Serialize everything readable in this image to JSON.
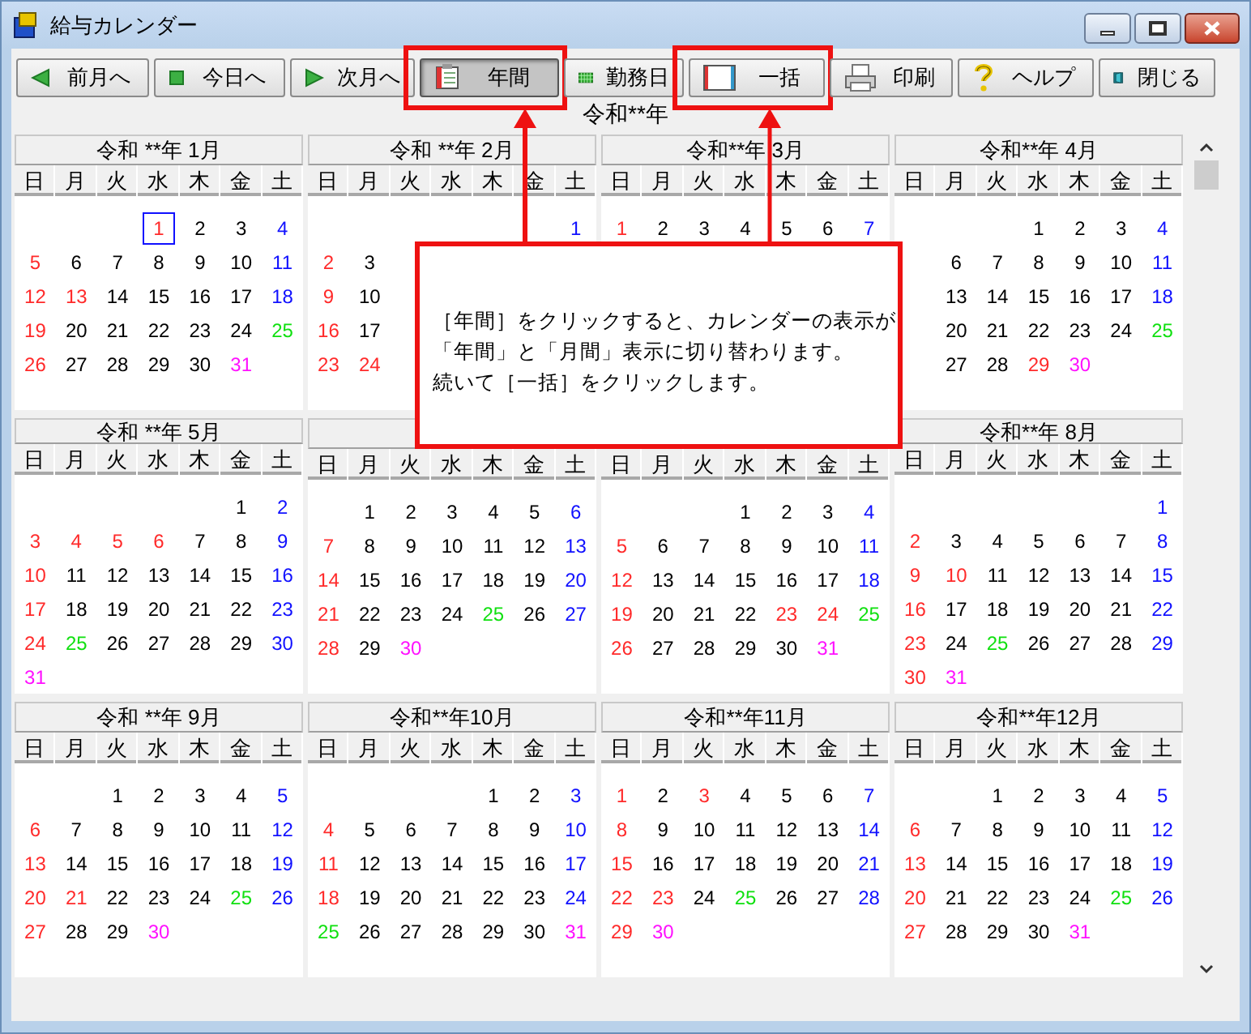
{
  "window": {
    "title": "給与カレンダー"
  },
  "toolbar": [
    {
      "label": "前月へ",
      "selected": false,
      "highlighted": false
    },
    {
      "label": "今日へ",
      "selected": false,
      "highlighted": false
    },
    {
      "label": "次月へ",
      "selected": false,
      "highlighted": false
    },
    {
      "label": "年間",
      "selected": true,
      "highlighted": true
    },
    {
      "label": "勤務日",
      "selected": false,
      "highlighted": false
    },
    {
      "label": "一括",
      "selected": false,
      "highlighted": true
    },
    {
      "label": "印刷",
      "selected": false,
      "highlighted": false
    },
    {
      "label": "ヘルプ",
      "selected": false,
      "highlighted": false
    },
    {
      "label": "閉じる",
      "selected": false,
      "highlighted": false
    }
  ],
  "year_title": "令和**年",
  "months": [
    {
      "title": "令和 **年 1月",
      "weekdays": [
        "日",
        "月",
        "火",
        "水",
        "木",
        "金",
        "土"
      ],
      "weeks": [
        [
          {
            "day": "1",
            "kind": "today"
          },
          {
            "day": "2",
            "kind": "plain"
          },
          {
            "day": "3",
            "kind": "plain"
          },
          {
            "day": "4",
            "kind": "sat"
          }
        ],
        [
          {
            "day": "5",
            "kind": "holiday"
          },
          {
            "day": "6",
            "kind": "plain"
          },
          {
            "day": "7",
            "kind": "plain"
          },
          {
            "day": "8",
            "kind": "plain"
          },
          {
            "day": "9",
            "kind": "plain"
          },
          {
            "day": "10",
            "kind": "plain"
          },
          {
            "day": "11",
            "kind": "sat"
          }
        ],
        [
          {
            "day": "12",
            "kind": "holiday"
          },
          {
            "day": "13",
            "kind": "holiday"
          },
          {
            "day": "14",
            "kind": "plain"
          },
          {
            "day": "15",
            "kind": "plain"
          },
          {
            "day": "16",
            "kind": "plain"
          },
          {
            "day": "17",
            "kind": "plain"
          },
          {
            "day": "18",
            "kind": "sat"
          }
        ],
        [
          {
            "day": "19",
            "kind": "holiday"
          },
          {
            "day": "20",
            "kind": "plain"
          },
          {
            "day": "21",
            "kind": "plain"
          },
          {
            "day": "22",
            "kind": "plain"
          },
          {
            "day": "23",
            "kind": "plain"
          },
          {
            "day": "24",
            "kind": "plain"
          },
          {
            "day": "25",
            "kind": "payday"
          }
        ],
        [
          {
            "day": "26",
            "kind": "holiday"
          },
          {
            "day": "27",
            "kind": "plain"
          },
          {
            "day": "28",
            "kind": "plain"
          },
          {
            "day": "29",
            "kind": "plain"
          },
          {
            "day": "30",
            "kind": "plain"
          },
          {
            "day": "31",
            "kind": "end"
          }
        ]
      ]
    },
    {
      "title": "令和 **年 2月",
      "weekdays": [
        "日",
        "月",
        "火",
        "水",
        "木",
        "金",
        "土"
      ],
      "weeks": [
        [
          {
            "day": "1",
            "kind": "sat"
          }
        ],
        [
          {
            "day": "2",
            "kind": "holiday"
          },
          {
            "day": "3",
            "kind": "plain"
          }
        ],
        [
          {
            "day": "9",
            "kind": "holiday"
          },
          {
            "day": "10",
            "kind": "plain"
          }
        ],
        [
          {
            "day": "16",
            "kind": "holiday"
          },
          {
            "day": "17",
            "kind": "plain"
          }
        ],
        [
          {
            "day": "23",
            "kind": "holiday"
          },
          {
            "day": "24",
            "kind": "holiday"
          }
        ]
      ]
    },
    {
      "title": "令和**年 3月",
      "weekdays": [
        "日",
        "月",
        "火",
        "水",
        "木",
        "金",
        "土"
      ],
      "weeks": [
        [
          {
            "day": "1",
            "kind": "holiday"
          },
          {
            "day": "2",
            "kind": "plain"
          },
          {
            "day": "3",
            "kind": "plain"
          },
          {
            "day": "4",
            "kind": "plain"
          },
          {
            "day": "5",
            "kind": "plain"
          },
          {
            "day": "6",
            "kind": "plain"
          },
          {
            "day": "7",
            "kind": "sat"
          }
        ]
      ]
    },
    {
      "title": "令和**年 4月",
      "weekdays": [
        "日",
        "月",
        "火",
        "水",
        "木",
        "金",
        "土"
      ],
      "weeks": [
        [
          {
            "day": "1",
            "kind": "plain"
          },
          {
            "day": "2",
            "kind": "plain"
          },
          {
            "day": "3",
            "kind": "plain"
          },
          {
            "day": "4",
            "kind": "sat"
          }
        ],
        [
          {
            "kind": "covered"
          },
          {
            "day": "6",
            "kind": "plain"
          },
          {
            "day": "7",
            "kind": "plain"
          },
          {
            "day": "8",
            "kind": "plain"
          },
          {
            "day": "9",
            "kind": "plain"
          },
          {
            "day": "10",
            "kind": "plain"
          },
          {
            "day": "11",
            "kind": "sat"
          }
        ],
        [
          {
            "kind": "covered"
          },
          {
            "day": "13",
            "kind": "plain"
          },
          {
            "day": "14",
            "kind": "plain"
          },
          {
            "day": "15",
            "kind": "plain"
          },
          {
            "day": "16",
            "kind": "plain"
          },
          {
            "day": "17",
            "kind": "plain"
          },
          {
            "day": "18",
            "kind": "sat"
          }
        ],
        [
          {
            "kind": "covered"
          },
          {
            "day": "20",
            "kind": "plain"
          },
          {
            "day": "21",
            "kind": "plain"
          },
          {
            "day": "22",
            "kind": "plain"
          },
          {
            "day": "23",
            "kind": "plain"
          },
          {
            "day": "24",
            "kind": "plain"
          },
          {
            "day": "25",
            "kind": "payday"
          }
        ],
        [
          {
            "kind": "covered"
          },
          {
            "day": "27",
            "kind": "plain"
          },
          {
            "day": "28",
            "kind": "plain"
          },
          {
            "day": "29",
            "kind": "holiday"
          },
          {
            "day": "30",
            "kind": "end"
          }
        ]
      ]
    },
    {
      "title": "令和 **年 5月",
      "weekdays": [
        "日",
        "月",
        "火",
        "水",
        "木",
        "金",
        "土"
      ],
      "weeks": [
        [
          {
            "day": "1",
            "kind": "plain"
          },
          {
            "day": "2",
            "kind": "sat"
          }
        ],
        [
          {
            "day": "3",
            "kind": "holiday"
          },
          {
            "day": "4",
            "kind": "holiday"
          },
          {
            "day": "5",
            "kind": "holiday"
          },
          {
            "day": "6",
            "kind": "holiday"
          },
          {
            "day": "7",
            "kind": "plain"
          },
          {
            "day": "8",
            "kind": "plain"
          },
          {
            "day": "9",
            "kind": "sat"
          }
        ],
        [
          {
            "day": "10",
            "kind": "holiday"
          },
          {
            "day": "11",
            "kind": "plain"
          },
          {
            "day": "12",
            "kind": "plain"
          },
          {
            "day": "13",
            "kind": "plain"
          },
          {
            "day": "14",
            "kind": "plain"
          },
          {
            "day": "15",
            "kind": "plain"
          },
          {
            "day": "16",
            "kind": "sat"
          }
        ],
        [
          {
            "day": "17",
            "kind": "holiday"
          },
          {
            "day": "18",
            "kind": "plain"
          },
          {
            "day": "19",
            "kind": "plain"
          },
          {
            "day": "20",
            "kind": "plain"
          },
          {
            "day": "21",
            "kind": "plain"
          },
          {
            "day": "22",
            "kind": "plain"
          },
          {
            "day": "23",
            "kind": "sat"
          }
        ],
        [
          {
            "day": "24",
            "kind": "holiday"
          },
          {
            "day": "25",
            "kind": "payday"
          },
          {
            "day": "26",
            "kind": "plain"
          },
          {
            "day": "27",
            "kind": "plain"
          },
          {
            "day": "28",
            "kind": "plain"
          },
          {
            "day": "29",
            "kind": "plain"
          },
          {
            "day": "30",
            "kind": "sat"
          }
        ],
        [
          {
            "day": "31",
            "kind": "end"
          }
        ]
      ]
    },
    {
      "header_shown": true,
      "weekdays": [
        "日",
        "月",
        "火",
        "水",
        "木",
        "金",
        "土"
      ],
      "weeks": [
        [
          {
            "day": "1",
            "kind": "plain"
          },
          {
            "day": "2",
            "kind": "plain"
          },
          {
            "day": "3",
            "kind": "plain"
          },
          {
            "day": "4",
            "kind": "plain"
          },
          {
            "day": "5",
            "kind": "plain"
          },
          {
            "day": "6",
            "kind": "sat"
          }
        ],
        [
          {
            "day": "7",
            "kind": "holiday"
          },
          {
            "day": "8",
            "kind": "plain"
          },
          {
            "day": "9",
            "kind": "plain"
          },
          {
            "day": "10",
            "kind": "plain"
          },
          {
            "day": "11",
            "kind": "plain"
          },
          {
            "day": "12",
            "kind": "plain"
          },
          {
            "day": "13",
            "kind": "sat"
          }
        ],
        [
          {
            "day": "14",
            "kind": "holiday"
          },
          {
            "day": "15",
            "kind": "plain"
          },
          {
            "day": "16",
            "kind": "plain"
          },
          {
            "day": "17",
            "kind": "plain"
          },
          {
            "day": "18",
            "kind": "plain"
          },
          {
            "day": "19",
            "kind": "plain"
          },
          {
            "day": "20",
            "kind": "sat"
          }
        ],
        [
          {
            "day": "21",
            "kind": "holiday"
          },
          {
            "day": "22",
            "kind": "plain"
          },
          {
            "day": "23",
            "kind": "plain"
          },
          {
            "day": "24",
            "kind": "plain"
          },
          {
            "day": "25",
            "kind": "payday"
          },
          {
            "day": "26",
            "kind": "plain"
          },
          {
            "day": "27",
            "kind": "sat"
          }
        ],
        [
          {
            "day": "28",
            "kind": "holiday"
          },
          {
            "day": "29",
            "kind": "plain"
          },
          {
            "day": "30",
            "kind": "end"
          }
        ]
      ]
    },
    {
      "weekdays": [
        "日",
        "月",
        "火",
        "水",
        "木",
        "金",
        "土"
      ],
      "weeks": [
        [
          {
            "day": "1",
            "kind": "plain"
          },
          {
            "day": "2",
            "kind": "plain"
          },
          {
            "day": "3",
            "kind": "plain"
          },
          {
            "day": "4",
            "kind": "sat"
          }
        ],
        [
          {
            "day": "5",
            "kind": "holiday"
          },
          {
            "day": "6",
            "kind": "plain"
          },
          {
            "day": "7",
            "kind": "plain"
          },
          {
            "day": "8",
            "kind": "plain"
          },
          {
            "day": "9",
            "kind": "plain"
          },
          {
            "day": "10",
            "kind": "plain"
          },
          {
            "day": "11",
            "kind": "sat"
          }
        ],
        [
          {
            "day": "12",
            "kind": "holiday"
          },
          {
            "day": "13",
            "kind": "plain"
          },
          {
            "day": "14",
            "kind": "plain"
          },
          {
            "day": "15",
            "kind": "plain"
          },
          {
            "day": "16",
            "kind": "plain"
          },
          {
            "day": "17",
            "kind": "plain"
          },
          {
            "day": "18",
            "kind": "sat"
          }
        ],
        [
          {
            "day": "19",
            "kind": "holiday"
          },
          {
            "day": "20",
            "kind": "plain"
          },
          {
            "day": "21",
            "kind": "plain"
          },
          {
            "day": "22",
            "kind": "plain"
          },
          {
            "day": "23",
            "kind": "holiday"
          },
          {
            "day": "24",
            "kind": "holiday"
          },
          {
            "day": "25",
            "kind": "payday"
          }
        ],
        [
          {
            "day": "26",
            "kind": "holiday"
          },
          {
            "day": "27",
            "kind": "plain"
          },
          {
            "day": "28",
            "kind": "plain"
          },
          {
            "day": "29",
            "kind": "plain"
          },
          {
            "day": "30",
            "kind": "plain"
          },
          {
            "day": "31",
            "kind": "end"
          }
        ]
      ]
    },
    {
      "title": "令和**年 8月",
      "weekdays": [
        "日",
        "月",
        "火",
        "水",
        "木",
        "金",
        "土"
      ],
      "weeks": [
        [
          {
            "day": "1",
            "kind": "sat"
          }
        ],
        [
          {
            "day": "2",
            "kind": "holiday"
          },
          {
            "day": "3",
            "kind": "plain"
          },
          {
            "day": "4",
            "kind": "plain"
          },
          {
            "day": "5",
            "kind": "plain"
          },
          {
            "day": "6",
            "kind": "plain"
          },
          {
            "day": "7",
            "kind": "plain"
          },
          {
            "day": "8",
            "kind": "sat"
          }
        ],
        [
          {
            "day": "9",
            "kind": "holiday"
          },
          {
            "day": "10",
            "kind": "holiday"
          },
          {
            "day": "11",
            "kind": "plain"
          },
          {
            "day": "12",
            "kind": "plain"
          },
          {
            "day": "13",
            "kind": "plain"
          },
          {
            "day": "14",
            "kind": "plain"
          },
          {
            "day": "15",
            "kind": "sat"
          }
        ],
        [
          {
            "day": "16",
            "kind": "holiday"
          },
          {
            "day": "17",
            "kind": "plain"
          },
          {
            "day": "18",
            "kind": "plain"
          },
          {
            "day": "19",
            "kind": "plain"
          },
          {
            "day": "20",
            "kind": "plain"
          },
          {
            "day": "21",
            "kind": "plain"
          },
          {
            "day": "22",
            "kind": "sat"
          }
        ],
        [
          {
            "day": "23",
            "kind": "holiday"
          },
          {
            "day": "24",
            "kind": "plain"
          },
          {
            "day": "25",
            "kind": "payday"
          },
          {
            "day": "26",
            "kind": "plain"
          },
          {
            "day": "27",
            "kind": "plain"
          },
          {
            "day": "28",
            "kind": "plain"
          },
          {
            "day": "29",
            "kind": "sat"
          }
        ],
        [
          {
            "day": "30",
            "kind": "holiday"
          },
          {
            "day": "31",
            "kind": "end"
          }
        ]
      ]
    },
    {
      "title": "令和 **年 9月",
      "weekdays": [
        "日",
        "月",
        "火",
        "水",
        "木",
        "金",
        "土"
      ],
      "weeks": [
        [
          {
            "day": "1",
            "kind": "plain"
          },
          {
            "day": "2",
            "kind": "plain"
          },
          {
            "day": "3",
            "kind": "plain"
          },
          {
            "day": "4",
            "kind": "plain"
          },
          {
            "day": "5",
            "kind": "sat"
          }
        ],
        [
          {
            "day": "6",
            "kind": "holiday"
          },
          {
            "day": "7",
            "kind": "plain"
          },
          {
            "day": "8",
            "kind": "plain"
          },
          {
            "day": "9",
            "kind": "plain"
          },
          {
            "day": "10",
            "kind": "plain"
          },
          {
            "day": "11",
            "kind": "plain"
          },
          {
            "day": "12",
            "kind": "sat"
          }
        ],
        [
          {
            "day": "13",
            "kind": "holiday"
          },
          {
            "day": "14",
            "kind": "plain"
          },
          {
            "day": "15",
            "kind": "plain"
          },
          {
            "day": "16",
            "kind": "plain"
          },
          {
            "day": "17",
            "kind": "plain"
          },
          {
            "day": "18",
            "kind": "plain"
          },
          {
            "day": "19",
            "kind": "sat"
          }
        ],
        [
          {
            "day": "20",
            "kind": "holiday"
          },
          {
            "day": "21",
            "kind": "holiday"
          },
          {
            "day": "22",
            "kind": "plain"
          },
          {
            "day": "23",
            "kind": "plain"
          },
          {
            "day": "24",
            "kind": "plain"
          },
          {
            "day": "25",
            "kind": "payday"
          },
          {
            "day": "26",
            "kind": "sat"
          }
        ],
        [
          {
            "day": "27",
            "kind": "holiday"
          },
          {
            "day": "28",
            "kind": "plain"
          },
          {
            "day": "29",
            "kind": "plain"
          },
          {
            "day": "30",
            "kind": "end"
          }
        ]
      ]
    },
    {
      "title": "令和**年10月",
      "weekdays": [
        "日",
        "月",
        "火",
        "水",
        "木",
        "金",
        "土"
      ],
      "weeks": [
        [
          {
            "day": "1",
            "kind": "plain"
          },
          {
            "day": "2",
            "kind": "plain"
          },
          {
            "day": "3",
            "kind": "sat"
          }
        ],
        [
          {
            "day": "4",
            "kind": "holiday"
          },
          {
            "day": "5",
            "kind": "plain"
          },
          {
            "day": "6",
            "kind": "plain"
          },
          {
            "day": "7",
            "kind": "plain"
          },
          {
            "day": "8",
            "kind": "plain"
          },
          {
            "day": "9",
            "kind": "plain"
          },
          {
            "day": "10",
            "kind": "sat"
          }
        ],
        [
          {
            "day": "11",
            "kind": "holiday"
          },
          {
            "day": "12",
            "kind": "plain"
          },
          {
            "day": "13",
            "kind": "plain"
          },
          {
            "day": "14",
            "kind": "plain"
          },
          {
            "day": "15",
            "kind": "plain"
          },
          {
            "day": "16",
            "kind": "plain"
          },
          {
            "day": "17",
            "kind": "sat"
          }
        ],
        [
          {
            "day": "18",
            "kind": "holiday"
          },
          {
            "day": "19",
            "kind": "plain"
          },
          {
            "day": "20",
            "kind": "plain"
          },
          {
            "day": "21",
            "kind": "plain"
          },
          {
            "day": "22",
            "kind": "plain"
          },
          {
            "day": "23",
            "kind": "plain"
          },
          {
            "day": "24",
            "kind": "sat"
          }
        ],
        [
          {
            "day": "25",
            "kind": "payday"
          },
          {
            "day": "26",
            "kind": "plain"
          },
          {
            "day": "27",
            "kind": "plain"
          },
          {
            "day": "28",
            "kind": "plain"
          },
          {
            "day": "29",
            "kind": "plain"
          },
          {
            "day": "30",
            "kind": "plain"
          },
          {
            "day": "31",
            "kind": "end"
          }
        ]
      ]
    },
    {
      "title": "令和**年11月",
      "weekdays": [
        "日",
        "月",
        "火",
        "水",
        "木",
        "金",
        "土"
      ],
      "weeks": [
        [
          {
            "day": "1",
            "kind": "holiday"
          },
          {
            "day": "2",
            "kind": "plain"
          },
          {
            "day": "3",
            "kind": "holiday"
          },
          {
            "day": "4",
            "kind": "plain"
          },
          {
            "day": "5",
            "kind": "plain"
          },
          {
            "day": "6",
            "kind": "plain"
          },
          {
            "day": "7",
            "kind": "sat"
          }
        ],
        [
          {
            "day": "8",
            "kind": "holiday"
          },
          {
            "day": "9",
            "kind": "plain"
          },
          {
            "day": "10",
            "kind": "plain"
          },
          {
            "day": "11",
            "kind": "plain"
          },
          {
            "day": "12",
            "kind": "plain"
          },
          {
            "day": "13",
            "kind": "plain"
          },
          {
            "day": "14",
            "kind": "sat"
          }
        ],
        [
          {
            "day": "15",
            "kind": "holiday"
          },
          {
            "day": "16",
            "kind": "plain"
          },
          {
            "day": "17",
            "kind": "plain"
          },
          {
            "day": "18",
            "kind": "plain"
          },
          {
            "day": "19",
            "kind": "plain"
          },
          {
            "day": "20",
            "kind": "plain"
          },
          {
            "day": "21",
            "kind": "sat"
          }
        ],
        [
          {
            "day": "22",
            "kind": "holiday"
          },
          {
            "day": "23",
            "kind": "holiday"
          },
          {
            "day": "24",
            "kind": "plain"
          },
          {
            "day": "25",
            "kind": "payday"
          },
          {
            "day": "26",
            "kind": "plain"
          },
          {
            "day": "27",
            "kind": "plain"
          },
          {
            "day": "28",
            "kind": "sat"
          }
        ],
        [
          {
            "day": "29",
            "kind": "holiday"
          },
          {
            "day": "30",
            "kind": "end"
          }
        ]
      ]
    },
    {
      "title": "令和**年12月",
      "weekdays": [
        "日",
        "月",
        "火",
        "水",
        "木",
        "金",
        "土"
      ],
      "weeks": [
        [
          {
            "day": "1",
            "kind": "plain"
          },
          {
            "day": "2",
            "kind": "plain"
          },
          {
            "day": "3",
            "kind": "plain"
          },
          {
            "day": "4",
            "kind": "plain"
          },
          {
            "day": "5",
            "kind": "sat"
          }
        ],
        [
          {
            "day": "6",
            "kind": "holiday"
          },
          {
            "day": "7",
            "kind": "plain"
          },
          {
            "day": "8",
            "kind": "plain"
          },
          {
            "day": "9",
            "kind": "plain"
          },
          {
            "day": "10",
            "kind": "plain"
          },
          {
            "day": "11",
            "kind": "plain"
          },
          {
            "day": "12",
            "kind": "sat"
          }
        ],
        [
          {
            "day": "13",
            "kind": "holiday"
          },
          {
            "day": "14",
            "kind": "plain"
          },
          {
            "day": "15",
            "kind": "plain"
          },
          {
            "day": "16",
            "kind": "plain"
          },
          {
            "day": "17",
            "kind": "plain"
          },
          {
            "day": "18",
            "kind": "plain"
          },
          {
            "day": "19",
            "kind": "sat"
          }
        ],
        [
          {
            "day": "20",
            "kind": "holiday"
          },
          {
            "day": "21",
            "kind": "plain"
          },
          {
            "day": "22",
            "kind": "plain"
          },
          {
            "day": "23",
            "kind": "plain"
          },
          {
            "day": "24",
            "kind": "plain"
          },
          {
            "day": "25",
            "kind": "payday"
          },
          {
            "day": "26",
            "kind": "sat"
          }
        ],
        [
          {
            "day": "27",
            "kind": "holiday"
          },
          {
            "day": "28",
            "kind": "plain"
          },
          {
            "day": "29",
            "kind": "plain"
          },
          {
            "day": "30",
            "kind": "plain"
          },
          {
            "day": "31",
            "kind": "end"
          }
        ]
      ]
    }
  ],
  "callout": {
    "lines": [
      "［年間］をクリックすると、カレンダーの表示が",
      "「年間」と「月間」表示に切り替わります。",
      "続いて［一括］をクリックします。"
    ]
  }
}
